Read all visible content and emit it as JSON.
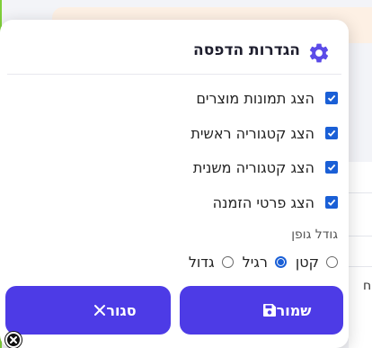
{
  "dialog": {
    "title": "הגדרות הדפסה",
    "options": [
      {
        "label": "הצג תמונות מוצרים",
        "checked": true
      },
      {
        "label": "הצג קטגוריה ראשית",
        "checked": true
      },
      {
        "label": "הצג קטגוריה משנית",
        "checked": true
      },
      {
        "label": "הצג פרטי הזמנה",
        "checked": true
      }
    ],
    "font_size": {
      "label": "גודל גופן",
      "options": [
        "קטן",
        "רגיל",
        "גדול"
      ],
      "selected": "רגיל"
    },
    "buttons": {
      "save_label": "שמור",
      "close_label": "סגור"
    }
  },
  "background": {
    "partial_char": "ח"
  },
  "colors": {
    "accent": "#4d3be6",
    "checkbox": "#1a5fd6"
  }
}
